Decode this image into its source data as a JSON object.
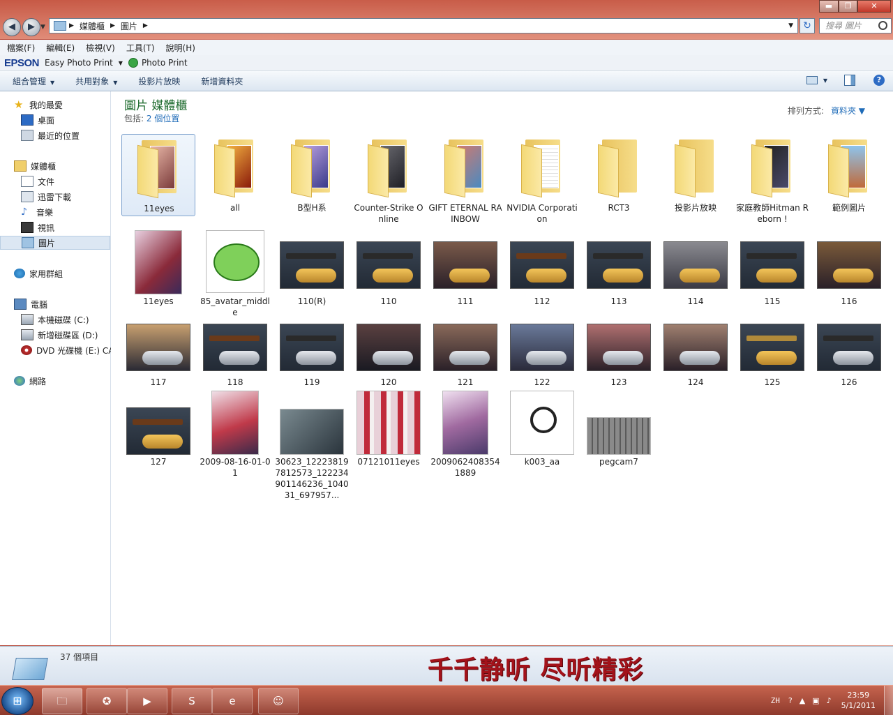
{
  "window": {
    "breadcrumb": [
      "媒體櫃",
      "圖片"
    ],
    "search_placeholder": "搜尋 圖片"
  },
  "menu": [
    "檔案(F)",
    "編輯(E)",
    "檢視(V)",
    "工具(T)",
    "說明(H)"
  ],
  "epson": {
    "logo": "EPSON",
    "easy_photo_print": "Easy Photo Print",
    "photo_print": "Photo Print"
  },
  "toolbar": {
    "organize": "組合管理",
    "share": "共用對象",
    "slideshow": "投影片放映",
    "new_folder": "新增資料夾"
  },
  "nav": {
    "favorites": "我的最愛",
    "desktop": "桌面",
    "recent": "最近的位置",
    "libraries": "媒體櫃",
    "documents": "文件",
    "thunder": "迅雷下載",
    "music": "音樂",
    "videos": "視訊",
    "pictures": "圖片",
    "homegroup": "家用群組",
    "computer": "電腦",
    "drive_c": "本機磁碟 (C:)",
    "drive_d": "新增磁碟區 (D:)",
    "drive_e": "DVD 光碟機 (E:) CA",
    "network": "網路"
  },
  "library": {
    "title": "圖片 媒體櫃",
    "includes_label": "包括:",
    "includes_link": "2 個位置",
    "arrange_label": "排列方式:",
    "arrange_value": "資料夾"
  },
  "folders": [
    {
      "name": "11eyes",
      "selected": true
    },
    {
      "name": "all"
    },
    {
      "name": "B型H系"
    },
    {
      "name": "Counter-Strike Online"
    },
    {
      "name": "GIFT ETERNAL RAINBOW"
    },
    {
      "name": "NVIDIA Corporation"
    },
    {
      "name": "RCT3"
    },
    {
      "name": "投影片放映"
    },
    {
      "name": "家庭教師Hitman Reborn !"
    },
    {
      "name": "範例圖片"
    }
  ],
  "files_row2": [
    "11eyes",
    "85_avatar_middle",
    "110(R)",
    "110",
    "111",
    "112",
    "113",
    "114",
    "115",
    "116"
  ],
  "files_row3": [
    "117",
    "118",
    "119",
    "120",
    "121",
    "122",
    "123",
    "124",
    "125",
    "126"
  ],
  "files_row4": [
    "127",
    "2009-08-16-01-01",
    "30623_122238197812573_122234901146236_104031_697957...",
    "07121011eyes",
    "20090624083541889",
    "k003_aa",
    "pegcam7"
  ],
  "status": {
    "item_count": "37 個項目",
    "banner": "千千静听 尽听精彩"
  },
  "taskbar": {
    "lang": "ZH",
    "time": "23:59",
    "date": "5/1/2011"
  },
  "colors": {
    "library_title": "#1e6b2e",
    "link": "#1e6bb8",
    "banner": "#a3121a",
    "selection": "#dce7f3"
  }
}
